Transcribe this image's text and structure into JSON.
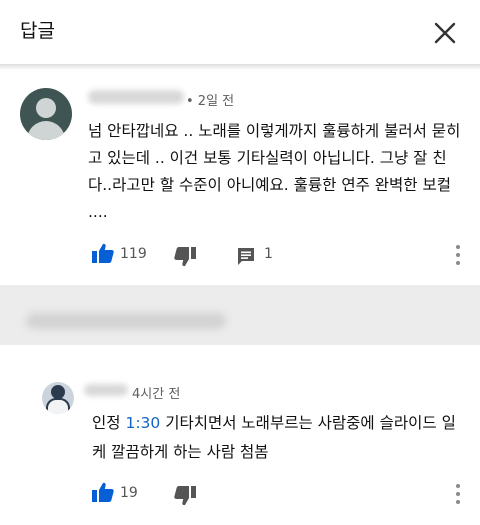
{
  "header": {
    "title": "답글",
    "close_icon": "close-icon"
  },
  "comment": {
    "meta": "• 2일 전",
    "text": "넘 안타깝네요 .. 노래를 이렇게까지 훌륭하게 불러서 묻히고 있는데 .. 이건 보통 기타실력이 아닙니다. 그냥 잘 친다..라고만 할 수준이 아니예요. 훌륭한 연주 완벽한 보컬 ....",
    "like_count": "119",
    "reply_count": "1"
  },
  "reply": {
    "meta": "4시간 전",
    "text_before": "인정 ",
    "timestamp": "1:30",
    "text_after": " 기타치면서 노래부르는 사람중에 슬라이드 일케 깔끔하게 하는 사람 첨봄",
    "like_count": "19"
  },
  "colors": {
    "accent": "#065fd4",
    "link": "#1565c0",
    "separator_bg": "#ececec"
  }
}
